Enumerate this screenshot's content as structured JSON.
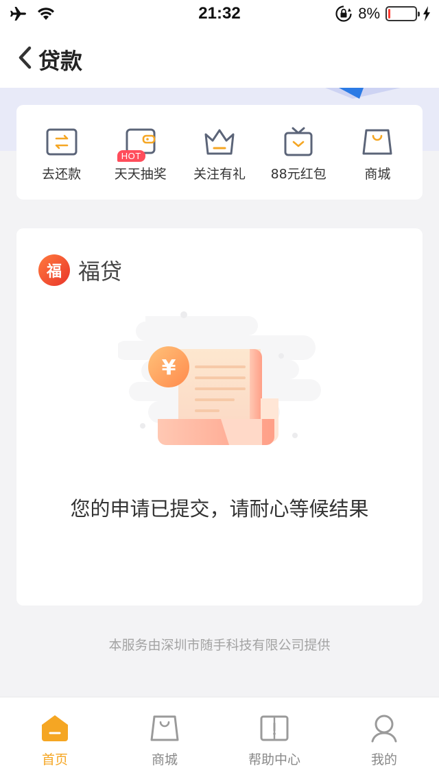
{
  "status_bar": {
    "time": "21:32",
    "battery_percent": "8%",
    "battery_level": 0.08,
    "icons": [
      "airplane-icon",
      "wifi-icon",
      "orientation-lock-icon",
      "charging-icon"
    ]
  },
  "nav": {
    "title": "贷款",
    "back_icon": "chevron-left-icon"
  },
  "quick_actions": [
    {
      "label": "去还款",
      "icon": "repay-icon"
    },
    {
      "label": "天天抽奖",
      "icon": "lottery-wallet-icon",
      "badge": "HOT"
    },
    {
      "label": "关注有礼",
      "icon": "crown-icon"
    },
    {
      "label": "88元红包",
      "icon": "red-packet-tv-icon"
    },
    {
      "label": "商城",
      "icon": "shopping-bag-icon"
    }
  ],
  "loan_card": {
    "brand_logo_text": "福",
    "brand_name": "福贷",
    "illustration_symbol": "¥",
    "message": "您的申请已提交，请耐心等候结果"
  },
  "provider_note": "本服务由深圳市随手科技有限公司提供",
  "tab_bar": {
    "items": [
      {
        "label": "首页",
        "icon": "home-icon",
        "active": true
      },
      {
        "label": "商城",
        "icon": "shopping-bag-icon",
        "active": false
      },
      {
        "label": "帮助中心",
        "icon": "help-book-icon",
        "active": false
      },
      {
        "label": "我的",
        "icon": "user-icon",
        "active": false
      }
    ],
    "active_color": "#f5a623",
    "inactive_color": "#888888"
  },
  "colors": {
    "brand_gradient_start": "#ff7a3d",
    "brand_gradient_end": "#e9352b",
    "hot_badge": "#ff4d5b",
    "icon_accent": "#f5a623",
    "icon_stroke": "#5b6478"
  }
}
